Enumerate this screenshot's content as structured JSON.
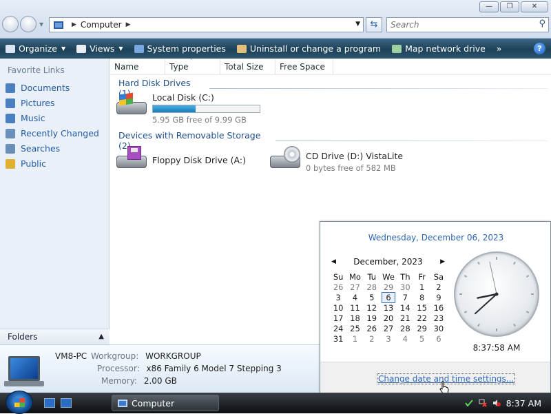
{
  "window": {
    "address_path": "Computer",
    "search_placeholder": "Search",
    "minimize_icon": "minimize-icon",
    "maximize_icon": "maximize-icon",
    "close_icon": "close-icon"
  },
  "commands": [
    {
      "label": "Organize",
      "icon": "organize-icon",
      "dropdown": true
    },
    {
      "label": "Views",
      "icon": "views-icon",
      "dropdown": true
    },
    {
      "label": "System properties",
      "icon": "system-properties-icon",
      "dropdown": false
    },
    {
      "label": "Uninstall or change a program",
      "icon": "uninstall-icon",
      "dropdown": false
    },
    {
      "label": "Map network drive",
      "icon": "map-network-drive-icon",
      "dropdown": false
    }
  ],
  "commands_more": "»",
  "favorite_links": {
    "title": "Favorite Links",
    "items": [
      "Documents",
      "Pictures",
      "Music",
      "Recently Changed",
      "Searches",
      "Public"
    ]
  },
  "folders_label": "Folders",
  "columns": [
    "Name",
    "Type",
    "Total Size",
    "Free Space"
  ],
  "groups": {
    "hard_disk": "Hard Disk Drives (1)",
    "removable": "Devices with Removable Storage (2)"
  },
  "drives": {
    "local_disk": {
      "name": "Local Disk (C:)",
      "free": "5.95 GB free of 9.99 GB",
      "used_fraction": 0.4
    },
    "floppy": {
      "name": "Floppy Disk Drive (A:)"
    },
    "cd": {
      "name": "CD Drive (D:) VistaLite",
      "free": "0 bytes free of 582 MB"
    }
  },
  "details": {
    "computer_name": "VM8-PC",
    "workgroup_label": "Workgroup:",
    "workgroup": "WORKGROUP",
    "processor_label": "Processor:",
    "processor": "x86 Family 6 Model 7 Stepping 3",
    "memory_label": "Memory:",
    "memory": "2.00 GB"
  },
  "calendar": {
    "long_date": "Wednesday, December 06, 2023",
    "month_label": "December, 2023",
    "weekdays": [
      "Su",
      "Mo",
      "Tu",
      "We",
      "Th",
      "Fr",
      "Sa"
    ],
    "weeks": [
      [
        {
          "d": "26",
          "o": true
        },
        {
          "d": "27",
          "o": true
        },
        {
          "d": "28",
          "o": true
        },
        {
          "d": "29",
          "o": true
        },
        {
          "d": "30",
          "o": true
        },
        {
          "d": "1"
        },
        {
          "d": "2"
        }
      ],
      [
        {
          "d": "3"
        },
        {
          "d": "4"
        },
        {
          "d": "5"
        },
        {
          "d": "6",
          "t": true
        },
        {
          "d": "7"
        },
        {
          "d": "8"
        },
        {
          "d": "9"
        }
      ],
      [
        {
          "d": "10"
        },
        {
          "d": "11"
        },
        {
          "d": "12"
        },
        {
          "d": "13"
        },
        {
          "d": "14"
        },
        {
          "d": "15"
        },
        {
          "d": "16"
        }
      ],
      [
        {
          "d": "17"
        },
        {
          "d": "18"
        },
        {
          "d": "19"
        },
        {
          "d": "20"
        },
        {
          "d": "21"
        },
        {
          "d": "22"
        },
        {
          "d": "23"
        }
      ],
      [
        {
          "d": "24"
        },
        {
          "d": "25"
        },
        {
          "d": "26"
        },
        {
          "d": "27"
        },
        {
          "d": "28"
        },
        {
          "d": "29"
        },
        {
          "d": "30"
        }
      ],
      [
        {
          "d": "31"
        },
        {
          "d": "1",
          "o": true
        },
        {
          "d": "2",
          "o": true
        },
        {
          "d": "3",
          "o": true
        },
        {
          "d": "4",
          "o": true
        },
        {
          "d": "5",
          "o": true
        },
        {
          "d": "6",
          "o": true
        }
      ]
    ],
    "clock_time": "8:37:58 AM",
    "settings_link": "Change date and time settings..."
  },
  "taskbar": {
    "window_button": "Computer",
    "clock": "8:37 AM"
  }
}
